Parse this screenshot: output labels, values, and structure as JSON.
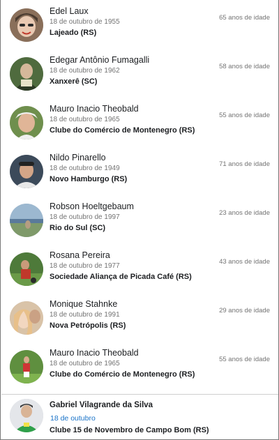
{
  "birthdays": [
    {
      "name": "Edel Laux",
      "date": "18 de outubro de 1955",
      "place": "Lajeado (RS)",
      "age": "65 anos de idade",
      "avatar_colors": [
        "#8a6f5a",
        "#e9c9b2",
        "#c0392b"
      ]
    },
    {
      "name": "Edegar Antônio Fumagalli",
      "date": "18 de outubro de 1962",
      "place": "Xanxerê (SC)",
      "age": "58 anos de idade",
      "avatar_colors": [
        "#4f6b3e",
        "#d6b89a",
        "#2d3a25"
      ]
    },
    {
      "name": "Mauro Inacio Theobald",
      "date": "18 de outubro de 1965",
      "place": "Clube do Comércio de Montenegro (RS)",
      "age": "55 anos de idade",
      "avatar_colors": [
        "#6f8f4d",
        "#e0b597",
        "#f0f0f0"
      ]
    },
    {
      "name": "Nildo Pinarello",
      "date": "18 de outubro de 1949",
      "place": "Novo Hamburgo (RS)",
      "age": "71 anos de idade",
      "avatar_colors": [
        "#3c4a5a",
        "#d3a587",
        "#e8e8e8"
      ]
    },
    {
      "name": "Robson Hoeltgebaum",
      "date": "18 de outubro de 1997",
      "place": "Rio do Sul (SC)",
      "age": "23 anos de idade",
      "avatar_colors": [
        "#9cb8d0",
        "#7f9a6a",
        "#b59d82"
      ]
    },
    {
      "name": "Rosana Pereira",
      "date": "18 de outubro de 1977",
      "place": "Sociedade Aliança de Picada Café (RS)",
      "age": "43 anos de idade",
      "avatar_colors": [
        "#4e7a3a",
        "#c99a7a",
        "#2a2a2a"
      ]
    },
    {
      "name": "Monique Stahnke",
      "date": "18 de outubro de 1991",
      "place": "Nova Petrópolis (RS)",
      "age": "29 anos de idade",
      "avatar_colors": [
        "#d9c3a8",
        "#e8c08a",
        "#f2d7c0"
      ]
    },
    {
      "name": "Mauro Inacio Theobald",
      "date": "18 de outubro de 1965",
      "place": "Clube do Comércio de Montenegro (RS)",
      "age": "55 anos de idade",
      "avatar_colors": [
        "#5f8f3f",
        "#cf3535",
        "#ffffff"
      ]
    }
  ],
  "last_entry": {
    "name": "Gabriel Vilagrande da Silva",
    "date": "18 de outubro",
    "place": "Clube 15 de Novembro de Campo Bom (RS)",
    "avatar_colors": [
      "#e4e6ea",
      "#3a3a3a",
      "#2fa04a"
    ]
  }
}
